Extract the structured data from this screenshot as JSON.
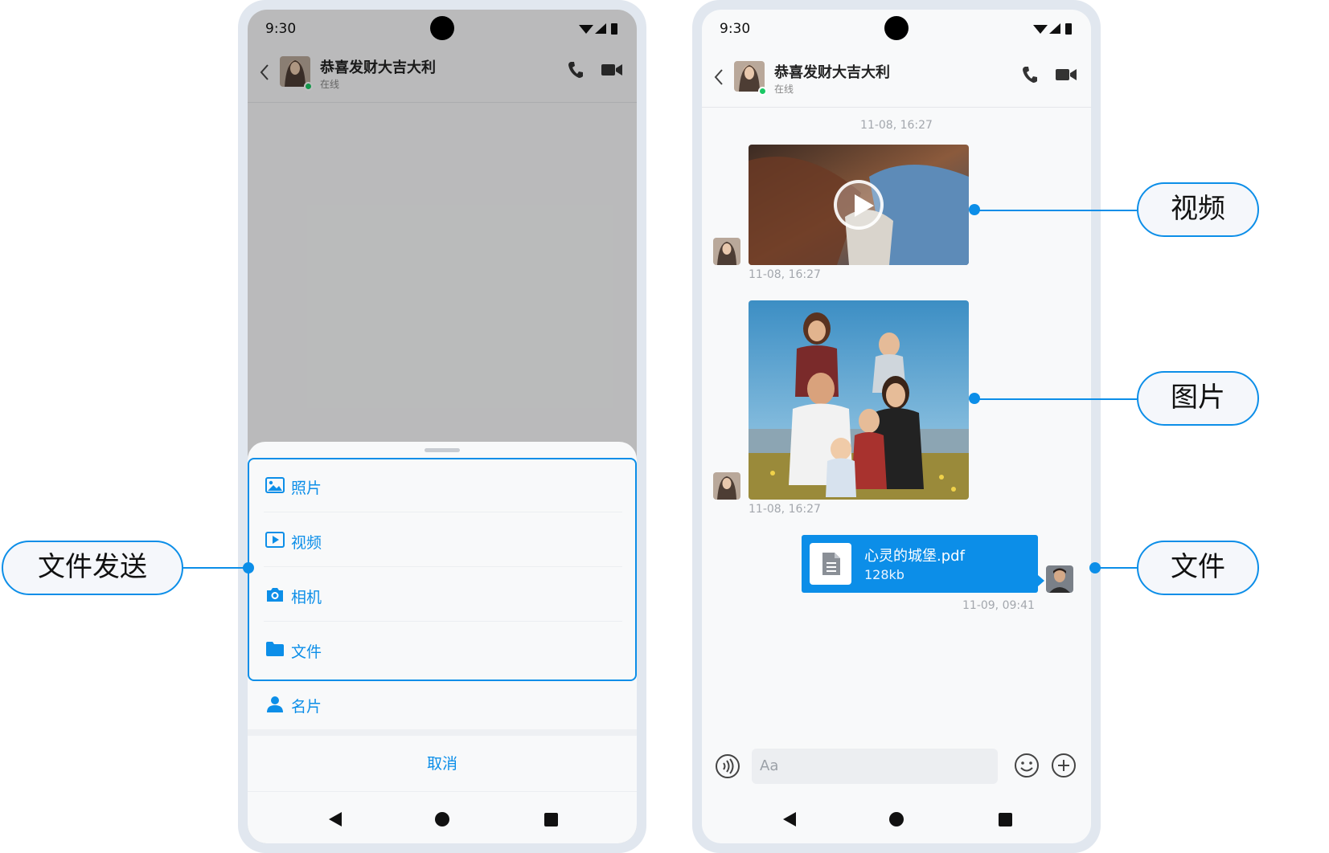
{
  "colors": {
    "accent": "#0c8ee8",
    "frame": "#e1e7ef",
    "online": "#1bc865"
  },
  "left_phone": {
    "status_time": "9:30",
    "chat_name": "恭喜发财大吉大利",
    "chat_status": "在线",
    "attach_menu": {
      "options": [
        {
          "label": "照片",
          "icon": "photo-icon"
        },
        {
          "label": "视频",
          "icon": "video-file-icon"
        },
        {
          "label": "相机",
          "icon": "camera-icon"
        },
        {
          "label": "文件",
          "icon": "folder-icon"
        },
        {
          "label": "名片",
          "icon": "person-card-icon"
        }
      ],
      "cancel_label": "取消"
    }
  },
  "right_phone": {
    "status_time": "9:30",
    "chat_name": "恭喜发财大吉大利",
    "chat_status": "在线",
    "top_timestamp": "11-08, 16:27",
    "messages": [
      {
        "type": "video",
        "timestamp": "11-08, 16:27"
      },
      {
        "type": "image",
        "timestamp": "11-08, 16:27"
      },
      {
        "type": "file",
        "file_name": "心灵的城堡.pdf",
        "file_size": "128kb",
        "timestamp": "11-09, 09:41"
      }
    ],
    "input_placeholder": "Aa"
  },
  "callouts": {
    "file_send": "文件发送",
    "video": "视频",
    "image": "图片",
    "file": "文件"
  }
}
